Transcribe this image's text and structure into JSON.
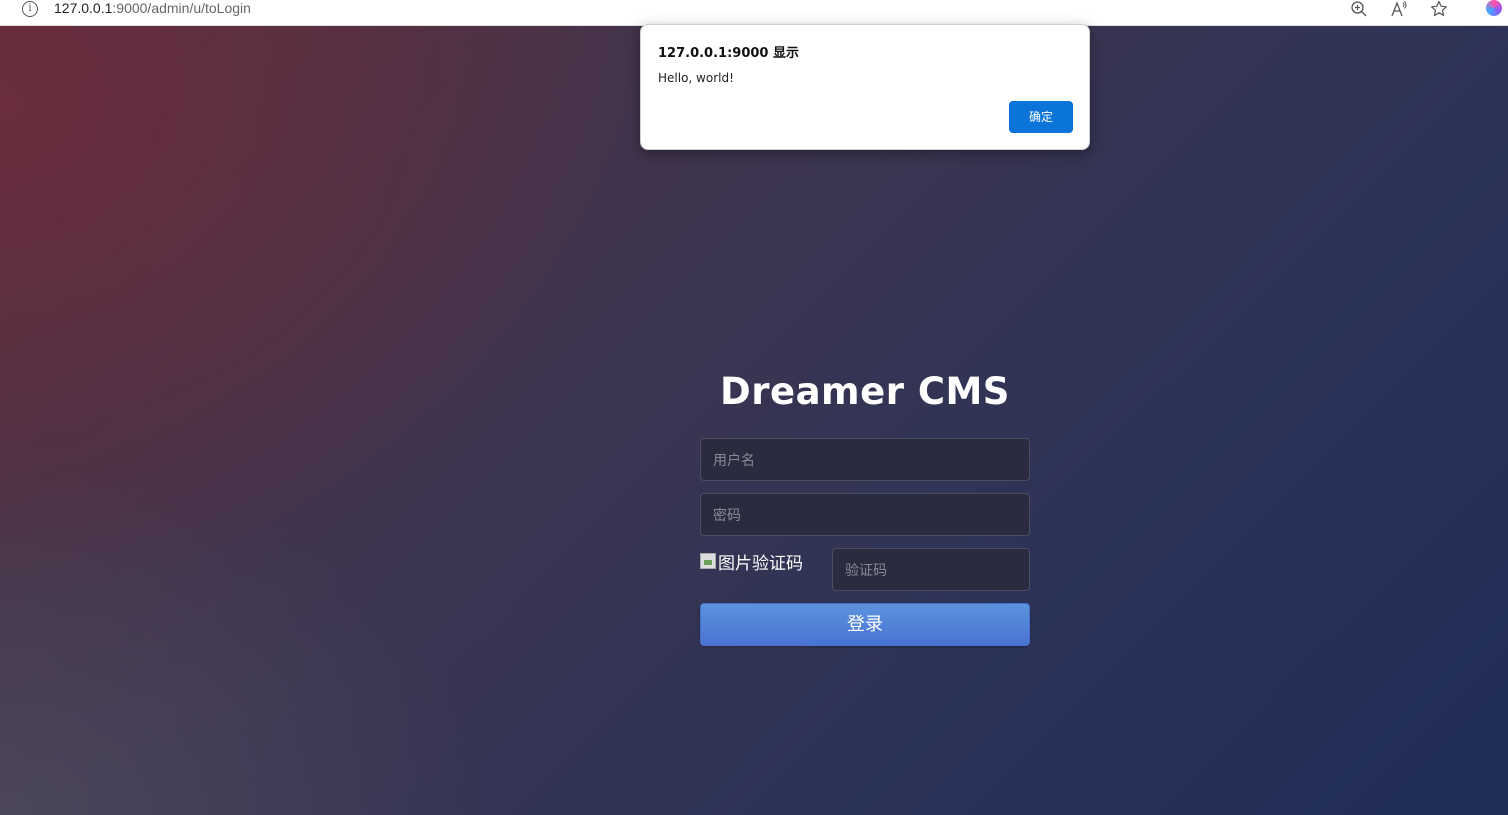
{
  "browser": {
    "url_host": "127.0.0.1",
    "url_rest": ":9000/admin/u/toLogin",
    "toolbar_icons": [
      "zoom-in-icon",
      "read-aloud-icon",
      "favorite-star-icon",
      "extension-icon"
    ]
  },
  "login": {
    "title": "Dreamer CMS",
    "username_placeholder": "用户名",
    "password_placeholder": "密码",
    "captcha_image_alt": "图片验证码",
    "captcha_placeholder": "验证码",
    "submit_label": "登录"
  },
  "dialog": {
    "title": "127.0.0.1:9000 显示",
    "message": "Hello, world!",
    "ok_label": "确定"
  },
  "colors": {
    "dialog_button": "#0b74d8",
    "login_button": "#5285d8",
    "input_background": "#2b2b40"
  }
}
